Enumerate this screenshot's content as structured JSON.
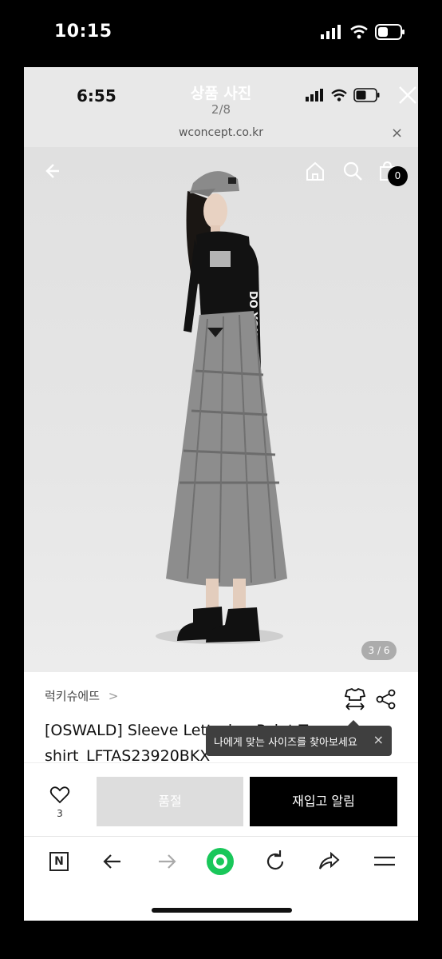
{
  "outer_status": {
    "time": "10:15"
  },
  "viewer": {
    "inner_time": "6:55",
    "title": "상품 사진",
    "counter": "2/8",
    "url": "wconcept.co.kr",
    "url_close": "×"
  },
  "product_page": {
    "cart_count": "0",
    "image_counter": "3 / 6",
    "brand": "럭키슈에뜨",
    "brand_chevron": ">",
    "title": "[OSWALD] Sleeve Lettering Point T-shirt_LFTAS23920BKX",
    "tooltip": "나에게 맞는 사이즈를 찾아보세요",
    "tooltip_close": "×",
    "like_count": "3",
    "soldout_label": "품절",
    "restock_label": "재입고 알림",
    "tshirt_print_sleeve": "DO YOU FEEL?"
  },
  "colors": {
    "accent_green": "#19c75a",
    "button_disabled": "#dddddd",
    "button_primary": "#000000"
  },
  "browser_toolbar": {
    "items": [
      "naver-icon",
      "back-arrow-icon",
      "forward-arrow-icon",
      "green-home-icon",
      "refresh-icon",
      "share-icon",
      "menu-icon"
    ],
    "naver_letter": "N"
  }
}
